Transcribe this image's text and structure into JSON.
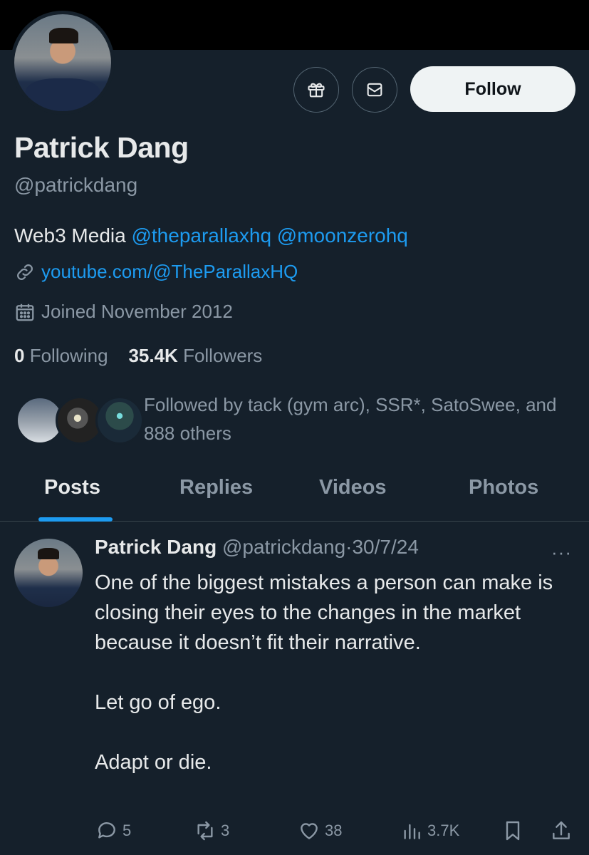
{
  "profile": {
    "name": "Patrick Dang",
    "handle": "@patrickdang",
    "follow_label": "Follow",
    "bio_text": "Web3 Media ",
    "bio_mention_1": "@theparallaxhq",
    "bio_mention_2": "@moonzerohq",
    "website": "youtube.com/@TheParallaxHQ",
    "joined": "Joined November 2012",
    "following_count": "0",
    "following_label": "Following",
    "followers_count": "35.4K",
    "followers_label": "Followers",
    "followed_by": "Followed by tack (gym arc), SSR*, SatoSwee, and 888 others"
  },
  "tabs": [
    {
      "label": "Posts"
    },
    {
      "label": "Replies"
    },
    {
      "label": "Videos"
    },
    {
      "label": "Photos"
    }
  ],
  "post": {
    "author": "Patrick Dang",
    "handle": "@patrickdang",
    "separator": "·",
    "date": "30/7/24",
    "more": "···",
    "paragraph_1": "One of the biggest mistakes a person can make is closing their eyes to the changes in the market because it doesn’t fit their narrative.",
    "paragraph_2": "Let go of ego.",
    "paragraph_3": "Adapt or die.",
    "replies": "5",
    "reposts": "3",
    "likes": "38",
    "views": "3.7K"
  },
  "colors": {
    "background": "#15202b",
    "accent": "#1d9bf0",
    "text_primary": "#e7e9ea",
    "text_secondary": "#8b98a5",
    "follow_button": "#eff3f4"
  },
  "icons": [
    "gift-icon",
    "mail-icon",
    "link-icon",
    "calendar-icon",
    "reply-icon",
    "repost-icon",
    "like-icon",
    "views-icon",
    "bookmark-icon",
    "share-icon"
  ]
}
